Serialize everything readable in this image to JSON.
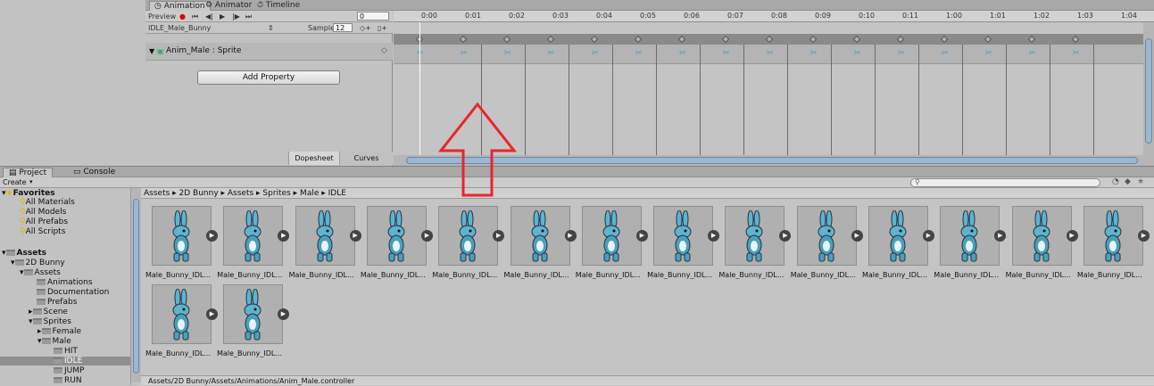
{
  "animation": {
    "tabs": [
      {
        "label": "◷ Animation"
      },
      {
        "label": "⚙ Animator"
      },
      {
        "label": "⏱ Timeline"
      }
    ],
    "preview_label": "Preview",
    "frame_value": "0",
    "clip_name": "IDLE_Male_Bunny",
    "samples_label": "Samples",
    "samples_value": "12",
    "property_name": "Anim_Male : Sprite",
    "add_property_label": "Add Property",
    "dopesheet_label": "Dopesheet",
    "curves_label": "Curves",
    "ruler_ticks": [
      "0:00",
      "0:01",
      "0:02",
      "0:03",
      "0:04",
      "0:05",
      "0:06",
      "0:07",
      "0:08",
      "0:09",
      "0:10",
      "0:11",
      "1:00",
      "1:01",
      "1:02",
      "1:03",
      "1:04"
    ]
  },
  "project": {
    "tabs": [
      {
        "label": "Project"
      },
      {
        "label": "Console"
      }
    ],
    "create_label": "Create",
    "breadcrumb": "Assets ▸ 2D Bunny ▸ Assets ▸ Sprites ▸ Male ▸ IDLE",
    "tree": [
      {
        "label": "Favorites"
      },
      {
        "label": "All Materials"
      },
      {
        "label": "All Models"
      },
      {
        "label": "All Prefabs"
      },
      {
        "label": "All Scripts"
      },
      {
        "label": "Assets"
      },
      {
        "label": "2D Bunny"
      },
      {
        "label": "Assets"
      },
      {
        "label": "Animations"
      },
      {
        "label": "Documentation"
      },
      {
        "label": "Prefabs"
      },
      {
        "label": "Scene"
      },
      {
        "label": "Sprites"
      },
      {
        "label": "Female"
      },
      {
        "label": "Male"
      },
      {
        "label": "HIT"
      },
      {
        "label": "IDLE"
      },
      {
        "label": "JUMP"
      },
      {
        "label": "RUN"
      }
    ],
    "asset_label": "Male_Bunny_IDL...",
    "status_path": "Assets/2D Bunny/Assets/Animations/Anim_Male.controller"
  },
  "colors": {
    "accent": "#e8262a",
    "scroll": "#9db6d2",
    "selected": "#8f8f8f"
  }
}
